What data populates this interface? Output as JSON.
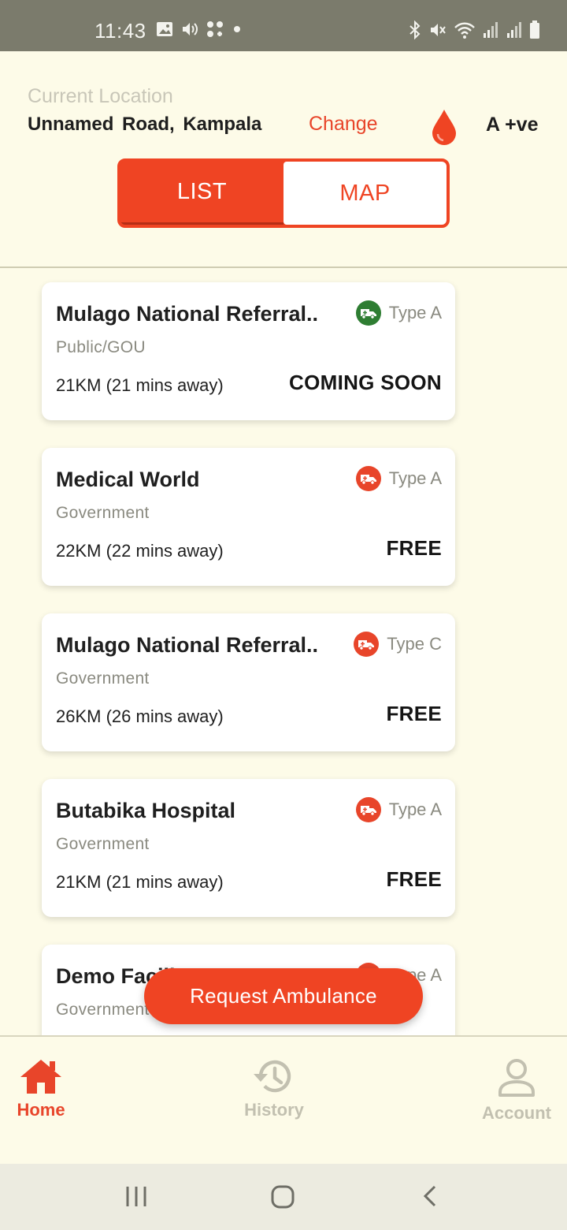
{
  "status_bar": {
    "time": "11:43",
    "left_icons": [
      "image-icon",
      "volume-icon",
      "dots-icon",
      "dot-icon"
    ],
    "right_icons": [
      "bluetooth-icon",
      "mute-icon",
      "wifi-icon",
      "signal-icon",
      "signal-icon",
      "battery-icon"
    ]
  },
  "header": {
    "location_caption": "Current Location",
    "location_address": "Unnamed Road,  Kampala",
    "change_label": "Change",
    "blood_type": "A +ve",
    "toggle": {
      "list_label": "LIST",
      "map_label": "MAP",
      "selected": "LIST"
    }
  },
  "facilities": [
    {
      "name": "Mulago National Referral..",
      "ownership": "Public/GOU",
      "distance": "21KM (21 mins away)",
      "price": "COMING SOON",
      "ambulance_type": "Type A",
      "badge_color": "#2e7d32"
    },
    {
      "name": "Medical World",
      "ownership": "Government",
      "distance": "22KM (22 mins away)",
      "price": "FREE",
      "ambulance_type": "Type A",
      "badge_color": "#e8452a"
    },
    {
      "name": "Mulago National Referral..",
      "ownership": "Government",
      "distance": "26KM (26 mins away)",
      "price": "FREE",
      "ambulance_type": "Type C",
      "badge_color": "#e8452a"
    },
    {
      "name": "Butabika Hospital",
      "ownership": "Government",
      "distance": "21KM (21 mins away)",
      "price": "FREE",
      "ambulance_type": "Type A",
      "badge_color": "#e8452a"
    },
    {
      "name": "Demo Facility",
      "ownership": "Government",
      "distance": "",
      "price": "",
      "ambulance_type": "Type A",
      "badge_color": "#e8452a"
    }
  ],
  "fab": {
    "label": "Request Ambulance"
  },
  "bottom_nav": [
    {
      "label": "Home",
      "icon": "home-icon",
      "active": true
    },
    {
      "label": "History",
      "icon": "history-icon",
      "active": false
    },
    {
      "label": "Account",
      "icon": "account-icon",
      "active": false
    }
  ],
  "system_nav": [
    "recents-icon",
    "home-circle-icon",
    "back-icon"
  ],
  "colors": {
    "accent": "#ef4423",
    "background": "#fdfbe8",
    "card": "#ffffff",
    "muted": "#8a8a80"
  }
}
